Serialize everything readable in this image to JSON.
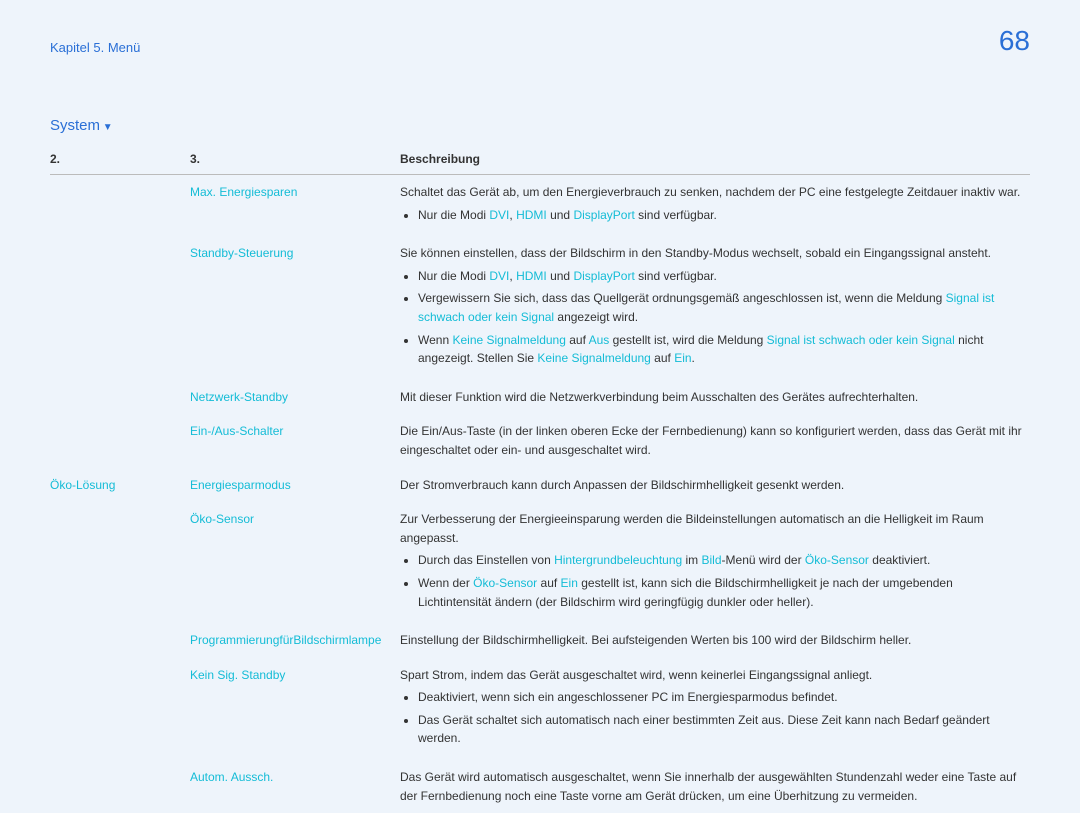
{
  "header": {
    "chapter": "Kapitel 5. Menü",
    "page": "68"
  },
  "section": "System",
  "columns": {
    "c1": "2.",
    "c2": "3.",
    "c3": "Beschreibung"
  },
  "group1": "Öko-Lösung",
  "rows": {
    "maxEnergie": {
      "label": "Max. Energiesparen",
      "desc": "Schaltet das Gerät ab, um den Energieverbrauch zu senken, nachdem der PC eine festgelegte Zeitdauer inaktiv war.",
      "b1a": "Nur die Modi ",
      "b1_dvi": "DVI",
      "b1b": ", ",
      "b1_hdmi": "HDMI",
      "b1c": " und ",
      "b1_dp": "DisplayPort",
      "b1d": " sind verfügbar."
    },
    "standby": {
      "label": "Standby-Steuerung",
      "desc": "Sie können einstellen, dass der Bildschirm in den Standby-Modus wechselt, sobald ein Eingangssignal ansteht.",
      "b1a": "Nur die Modi ",
      "b1_dvi": "DVI",
      "b1b": ", ",
      "b1_hdmi": "HDMI",
      "b1c": " und ",
      "b1_dp": "DisplayPort",
      "b1d": " sind verfügbar.",
      "b2a": "Vergewissern Sie sich, dass das Quellgerät ordnungsgemäß angeschlossen ist, wenn die Meldung ",
      "b2_sig": "Signal ist schwach oder kein Signal",
      "b2b": " angezeigt wird.",
      "b3a": "Wenn ",
      "b3_k1": "Keine Signalmeldung",
      "b3b": " auf ",
      "b3_aus": "Aus",
      "b3c": " gestellt ist, wird die Meldung ",
      "b3_sig": "Signal ist schwach oder kein Signal",
      "b3d": " nicht angezeigt. Stellen Sie ",
      "b3_k2": "Keine Signalmeldung",
      "b3e": " auf ",
      "b3_ein": "Ein",
      "b3f": "."
    },
    "netz": {
      "label": "Netzwerk-Standby",
      "desc": "Mit dieser Funktion wird die Netzwerkverbindung beim Ausschalten des Gerätes aufrechterhalten."
    },
    "einAus": {
      "label": "Ein-/Aus-Schalter",
      "desc": "Die Ein/Aus-Taste (in der linken oberen Ecke der Fernbedienung) kann so konfiguriert werden, dass das Gerät mit ihr eingeschaltet oder ein- und ausgeschaltet wird."
    },
    "spar": {
      "label": "Energiesparmodus",
      "desc": "Der Stromverbrauch kann durch Anpassen der Bildschirmhelligkeit gesenkt werden."
    },
    "sensor": {
      "label": "Öko-Sensor",
      "desc": "Zur Verbesserung der Energieeinsparung werden die Bildeinstellungen automatisch an die Helligkeit im Raum angepasst.",
      "b1a": "Durch das Einstellen von ",
      "b1_h": "Hintergrundbeleuchtung",
      "b1b": " im ",
      "b1_bild": "Bild",
      "b1c": "-Menü wird der ",
      "b1_s": "Öko-Sensor",
      "b1d": " deaktiviert.",
      "b2a": "Wenn der ",
      "b2_s": "Öko-Sensor",
      "b2b": " auf ",
      "b2_ein": "Ein",
      "b2c": " gestellt ist, kann sich die Bildschirmhelligkeit je nach der umgebenden Lichtintensität ändern (der Bildschirm wird geringfügig dunkler oder heller)."
    },
    "prog": {
      "label": "ProgrammierungfürBildschirmlampe",
      "desc": "Einstellung der Bildschirmhelligkeit. Bei aufsteigenden Werten bis 100 wird der Bildschirm heller."
    },
    "keinSig": {
      "label": "Kein Sig. Standby",
      "desc": "Spart Strom, indem das Gerät ausgeschaltet wird, wenn keinerlei Eingangssignal anliegt.",
      "b1": "Deaktiviert, wenn sich ein angeschlossener PC im Energiesparmodus befindet.",
      "b2": "Das Gerät schaltet sich automatisch nach einer bestimmten Zeit aus. Diese Zeit kann nach Bedarf geändert werden."
    },
    "autom": {
      "label": "Autom. Aussch.",
      "desc": "Das Gerät wird automatisch ausgeschaltet, wenn Sie innerhalb der ausgewählten Stundenzahl weder eine Taste auf der Fernbedienung noch eine Taste vorne am Gerät drücken, um eine Überhitzung zu vermeiden."
    }
  }
}
